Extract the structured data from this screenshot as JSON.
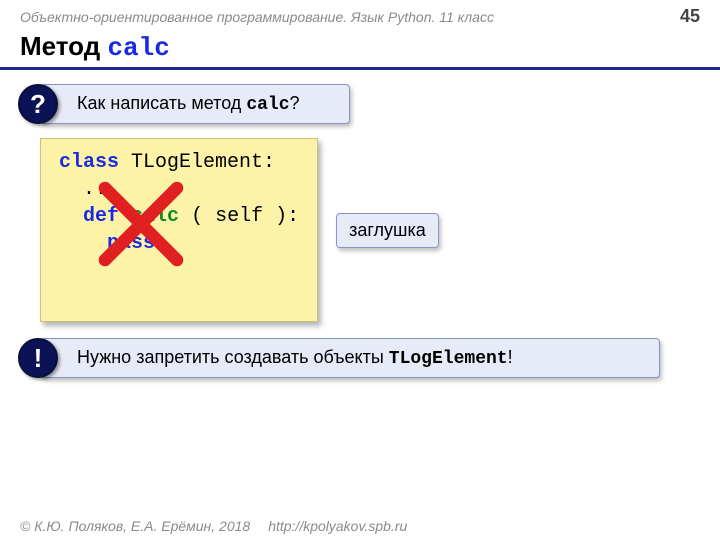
{
  "header": {
    "course": "Объектно-ориентированное программирование. Язык Python. 11 класс",
    "page": "45"
  },
  "title": {
    "prefix": "Метод ",
    "code": "calc"
  },
  "question": {
    "badge": "?",
    "text_before": "Как написать метод ",
    "code": "calc",
    "text_after": "?"
  },
  "code": {
    "l1a": "class",
    "l1b": " TLogElement:",
    "l2": "  ...",
    "l3a": "  ",
    "l3b": "def",
    "l3c": " ",
    "l3d": "calc",
    "l3e": " ( self ):",
    "l4a": "    ",
    "l4b": "pass"
  },
  "tag": {
    "label": "заглушка"
  },
  "warning": {
    "badge": "!",
    "text_before": "Нужно запретить создавать объекты ",
    "code": "TLogElement",
    "text_after": "!"
  },
  "footer": {
    "copyright": "© К.Ю. Поляков, Е.А. Ерёмин, 2018",
    "url": "http://kpolyakov.spb.ru"
  }
}
